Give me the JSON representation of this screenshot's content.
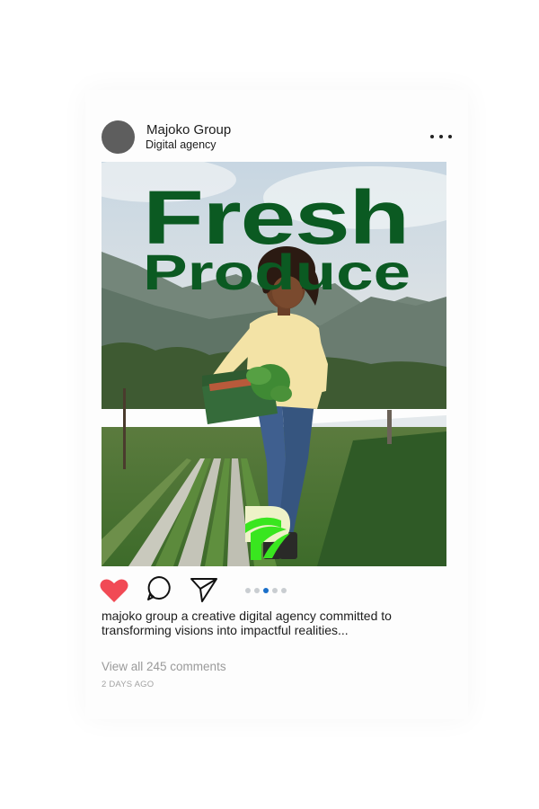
{
  "post": {
    "account_name": "Majoko Group",
    "account_subtitle": "Digital agency",
    "more_icon": "more-horizontal-icon",
    "image": {
      "headline_line1": "Fresh",
      "headline_line2": "Produce",
      "headline_color": "#0b5a22",
      "logo_accent": "#39e61f",
      "logo_cream": "#eef2c8"
    },
    "actions": {
      "like_icon": "heart-icon",
      "like_color": "#f14a55",
      "comment_icon": "comment-icon",
      "share_icon": "send-icon"
    },
    "carousel": {
      "total": 5,
      "active_index": 2,
      "active_color": "#1a6fc9"
    },
    "caption": "majoko group a creative digital agency committed to transforming visions into impactful realities...",
    "comments_link": "View all 245 comments",
    "timestamp": "2 DAYS AGO"
  }
}
